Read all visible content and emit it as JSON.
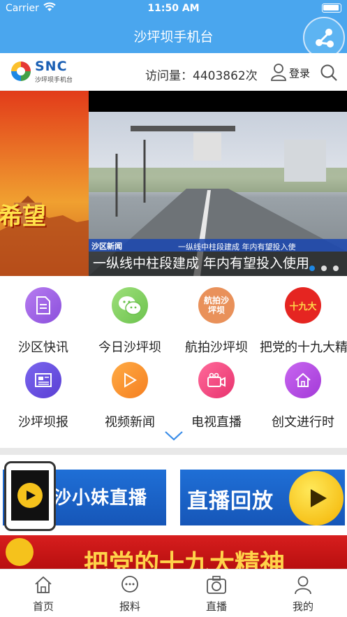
{
  "status": {
    "carrier": "Carrier",
    "time": "11:50 AM"
  },
  "nav": {
    "title": "沙坪坝手机台"
  },
  "header": {
    "logo_text": "SNC",
    "logo_sub": "沙坪坝手机台",
    "visits": "访问量：4403862次",
    "login": "登录"
  },
  "banner": {
    "left_text": "希望",
    "caption": "一纵线中柱段建成 年内有望投入使用",
    "ticker": "一纵线中柱段建成 年内有望投入使",
    "tv_logo": "沙区新闻"
  },
  "grid": [
    {
      "label": "沙区快讯",
      "icon": "document-icon",
      "color": "#a368e6"
    },
    {
      "label": "今日沙坪坝",
      "icon": "wechat-icon",
      "color": "#84d06a"
    },
    {
      "label": "航拍沙坪坝",
      "icon": "aerial-badge-icon",
      "color": "#e0834d",
      "badge": "航拍沙坪坝"
    },
    {
      "label": "把党的十九大精神",
      "icon": "nineteenth-congress-icon",
      "color": "#e52521",
      "badge": "十九大"
    },
    {
      "label": "沙坪坝报",
      "icon": "newspaper-icon",
      "color": "#6a4fe0"
    },
    {
      "label": "视频新闻",
      "icon": "play-icon",
      "color": "#f79732"
    },
    {
      "label": "电视直播",
      "icon": "camera-icon",
      "color": "#f0477f"
    },
    {
      "label": "创文进行时",
      "icon": "home-icon",
      "color": "#b84de4"
    }
  ],
  "promos": {
    "live": "沙小妹直播",
    "replay": "直播回放",
    "party": "把党的十九大精神"
  },
  "tabs": [
    {
      "label": "首页",
      "icon": "home-icon"
    },
    {
      "label": "报料",
      "icon": "chat-icon"
    },
    {
      "label": "直播",
      "icon": "camera-icon"
    },
    {
      "label": "我的",
      "icon": "user-icon"
    }
  ]
}
